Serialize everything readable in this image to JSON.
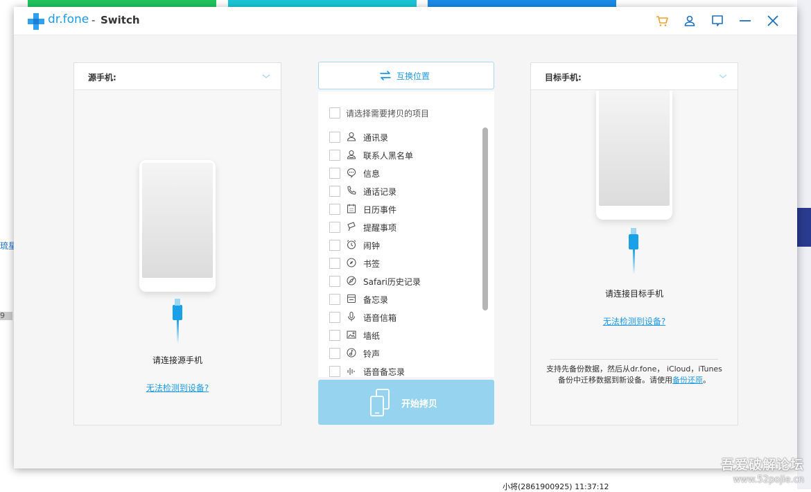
{
  "window": {
    "brand": "dr.fone",
    "separator": "-",
    "app": "Switch"
  },
  "background": {
    "left_link": "琉星社区",
    "left_num": "9",
    "bottom_text": "小将(2861900925)  11:37:12",
    "watermark_line1": "吾爱破解论坛",
    "watermark_line2": "www.52pojie.cn"
  },
  "source": {
    "label": "源手机:",
    "connect": "请连接源手机",
    "cannot_detect": "无法检测到设备?"
  },
  "target": {
    "label": "目标手机:",
    "connect": "请连接目标手机",
    "cannot_detect": "无法检测到设备?",
    "tip_text": "支持先备份数据，然后从dr.fone， iCloud，iTunes备份中迁移数据到新设备。请使用",
    "tip_link": "备份还原",
    "tip_end": "。"
  },
  "middle": {
    "swap_label": "互换位置",
    "select_all": "请选择需要拷贝的项目",
    "start_label": "开始拷贝",
    "items": [
      {
        "label": "通讯录",
        "icon": "person-icon"
      },
      {
        "label": "联系人黑名单",
        "icon": "blocked-person-icon"
      },
      {
        "label": "信息",
        "icon": "message-icon"
      },
      {
        "label": "通话记录",
        "icon": "phone-icon"
      },
      {
        "label": "日历事件",
        "icon": "calendar-icon"
      },
      {
        "label": "提醒事项",
        "icon": "reminder-icon"
      },
      {
        "label": "闹钟",
        "icon": "alarm-icon"
      },
      {
        "label": "书签",
        "icon": "compass-icon"
      },
      {
        "label": "Safari历史记录",
        "icon": "safari-icon"
      },
      {
        "label": "备忘录",
        "icon": "note-icon"
      },
      {
        "label": "语音信箱",
        "icon": "mic-icon"
      },
      {
        "label": "墙纸",
        "icon": "wallpaper-icon"
      },
      {
        "label": "铃声",
        "icon": "music-icon"
      },
      {
        "label": "语音备忘录",
        "icon": "waveform-icon"
      }
    ]
  },
  "colors": {
    "accent": "#1e9ae8",
    "start_button": "#96d3ef",
    "cart": "#f0a030"
  }
}
